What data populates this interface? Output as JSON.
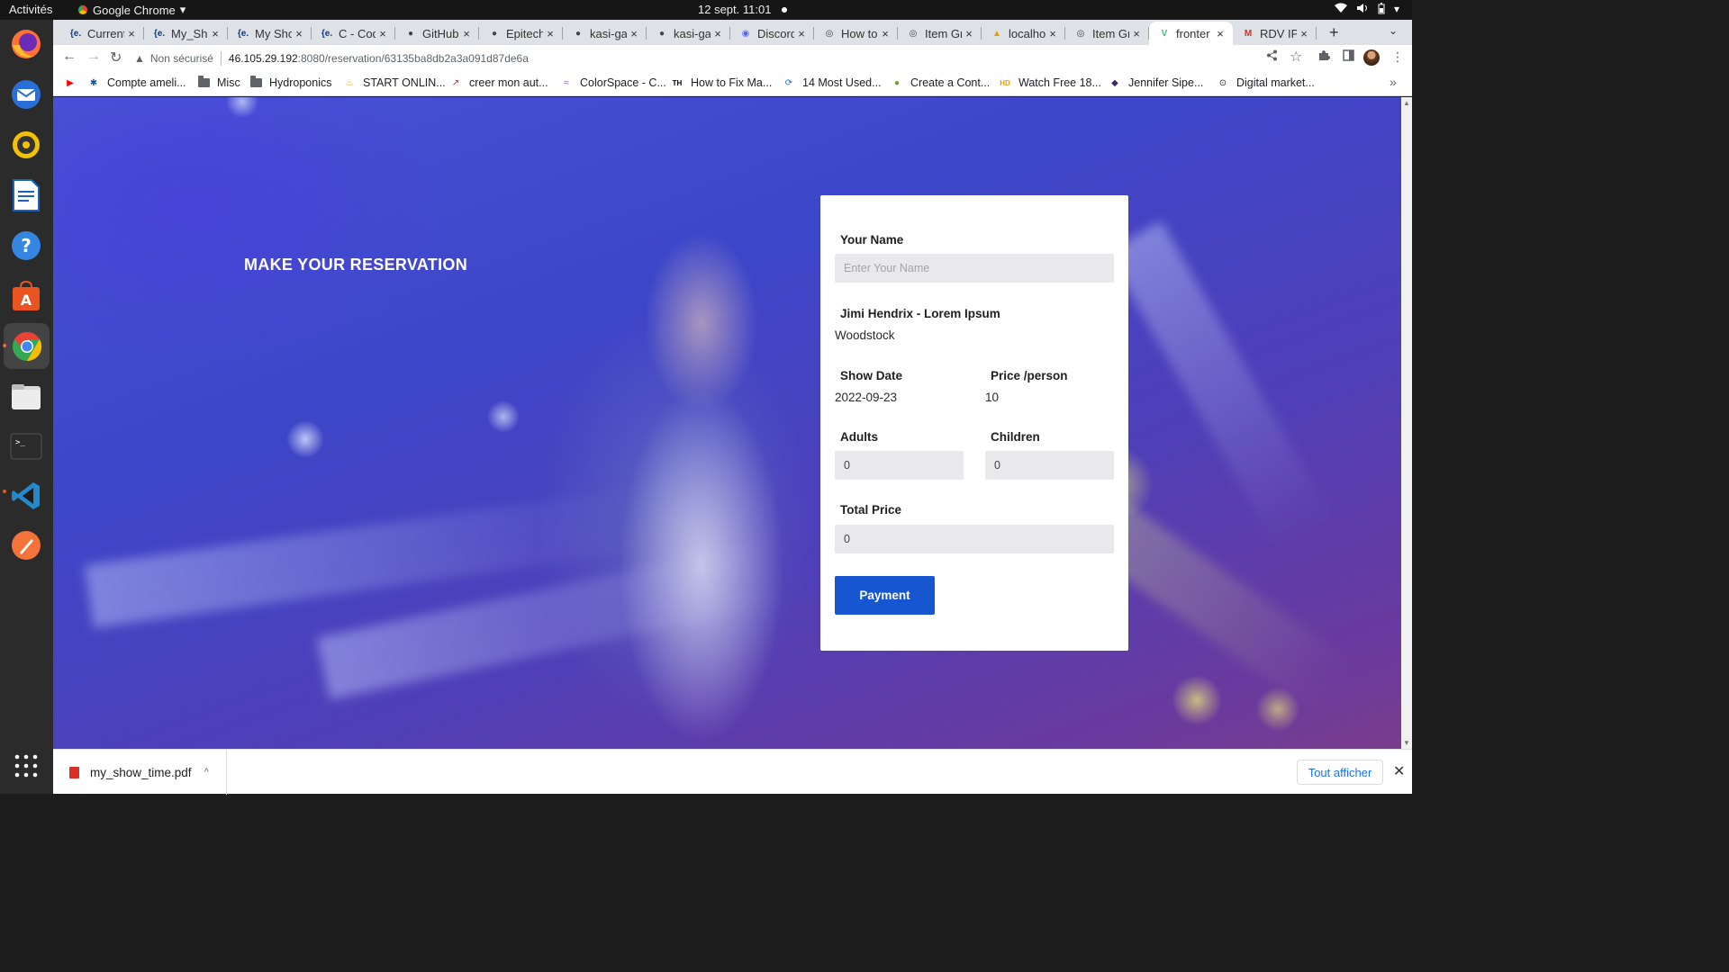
{
  "system": {
    "activities": "Activités",
    "app_name": "Google Chrome",
    "clock": "12 sept.  11:01"
  },
  "tabs": [
    {
      "title": "Current",
      "icon": "epitech-icon",
      "fav": "{e."
    },
    {
      "title": "My_Sho",
      "icon": "epitech-icon",
      "fav": "{e."
    },
    {
      "title": "My Sho",
      "icon": "epitech-icon",
      "fav": "{e."
    },
    {
      "title": "C - Cod",
      "icon": "epitech-icon",
      "fav": "{e."
    },
    {
      "title": "GitHub",
      "icon": "github-icon",
      "fav": "●"
    },
    {
      "title": "Epitech",
      "icon": "github-icon",
      "fav": "●"
    },
    {
      "title": "kasi-ga",
      "icon": "github-icon",
      "fav": "●"
    },
    {
      "title": "kasi-ga",
      "icon": "github-icon",
      "fav": "●"
    },
    {
      "title": "Discord",
      "icon": "discord-icon",
      "fav": "◉"
    },
    {
      "title": "How to",
      "icon": "globe-icon",
      "fav": "◎"
    },
    {
      "title": "Item Gr",
      "icon": "globe-icon",
      "fav": "◎"
    },
    {
      "title": "localho",
      "icon": "pma-icon",
      "fav": "▲"
    },
    {
      "title": "Item Gr",
      "icon": "globe-icon",
      "fav": "◎"
    },
    {
      "title": "fronter",
      "icon": "vue-icon",
      "fav": "V",
      "active": true
    },
    {
      "title": "RDV IP",
      "icon": "gmail-icon",
      "fav": "M"
    }
  ],
  "toolbar": {
    "security": "Non sécurisé",
    "url_host": "46.105.29.192",
    "url_path": ":8080/reservation/63135ba8db2a3a091d87de6a"
  },
  "bookmarks": [
    {
      "label": "",
      "icon": "youtube-icon"
    },
    {
      "label": "Compte ameli...",
      "icon": "ameli-icon"
    },
    {
      "label": "Misc",
      "icon": "folder-icon"
    },
    {
      "label": "Hydroponics",
      "icon": "folder-icon"
    },
    {
      "label": "START ONLIN...",
      "icon": "flame-icon"
    },
    {
      "label": "creer mon aut...",
      "icon": "link-icon"
    },
    {
      "label": "ColorSpace - C...",
      "icon": "colorspace-icon"
    },
    {
      "label": "How to Fix Ma...",
      "icon": "th-icon"
    },
    {
      "label": "14 Most Used...",
      "icon": "refresh-icon"
    },
    {
      "label": "Create a Cont...",
      "icon": "leaf-icon"
    },
    {
      "label": "Watch Free 18...",
      "icon": "hd-icon"
    },
    {
      "label": "Jennifer Sipe...",
      "icon": "person-icon"
    },
    {
      "label": "Digital market...",
      "icon": "download-circle-icon"
    }
  ],
  "page": {
    "headline": "MAKE YOUR RESERVATION",
    "form": {
      "name_label": "Your Name",
      "name_placeholder": "Enter Your Name",
      "show_title": "Jimi Hendrix - Lorem Ipsum",
      "show_venue": "Woodstock",
      "date_label": "Show Date",
      "date_value": "2022-09-23",
      "price_label": "Price /person",
      "price_value": "10",
      "adults_label": "Adults",
      "adults_value": "0",
      "children_label": "Children",
      "children_value": "0",
      "total_label": "Total Price",
      "total_value": "0",
      "payment_label": "Payment"
    }
  },
  "downloads": {
    "file": "my_show_time.pdf",
    "show_all": "Tout afficher"
  },
  "colors": {
    "accent_button": "#1756d1",
    "form_input_bg": "#e9e9ec"
  }
}
